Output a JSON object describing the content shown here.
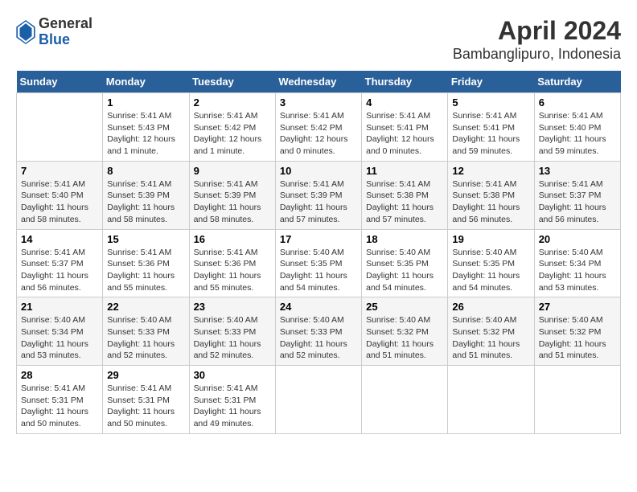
{
  "header": {
    "logo": {
      "line1": "General",
      "line2": "Blue"
    },
    "title": "April 2024",
    "subtitle": "Bambanglipuro, Indonesia"
  },
  "days_of_week": [
    "Sunday",
    "Monday",
    "Tuesday",
    "Wednesday",
    "Thursday",
    "Friday",
    "Saturday"
  ],
  "weeks": [
    [
      {
        "num": "",
        "info": ""
      },
      {
        "num": "1",
        "info": "Sunrise: 5:41 AM\nSunset: 5:43 PM\nDaylight: 12 hours\nand 1 minute."
      },
      {
        "num": "2",
        "info": "Sunrise: 5:41 AM\nSunset: 5:42 PM\nDaylight: 12 hours\nand 1 minute."
      },
      {
        "num": "3",
        "info": "Sunrise: 5:41 AM\nSunset: 5:42 PM\nDaylight: 12 hours\nand 0 minutes."
      },
      {
        "num": "4",
        "info": "Sunrise: 5:41 AM\nSunset: 5:41 PM\nDaylight: 12 hours\nand 0 minutes."
      },
      {
        "num": "5",
        "info": "Sunrise: 5:41 AM\nSunset: 5:41 PM\nDaylight: 11 hours\nand 59 minutes."
      },
      {
        "num": "6",
        "info": "Sunrise: 5:41 AM\nSunset: 5:40 PM\nDaylight: 11 hours\nand 59 minutes."
      }
    ],
    [
      {
        "num": "7",
        "info": "Sunrise: 5:41 AM\nSunset: 5:40 PM\nDaylight: 11 hours\nand 58 minutes."
      },
      {
        "num": "8",
        "info": "Sunrise: 5:41 AM\nSunset: 5:39 PM\nDaylight: 11 hours\nand 58 minutes."
      },
      {
        "num": "9",
        "info": "Sunrise: 5:41 AM\nSunset: 5:39 PM\nDaylight: 11 hours\nand 58 minutes."
      },
      {
        "num": "10",
        "info": "Sunrise: 5:41 AM\nSunset: 5:39 PM\nDaylight: 11 hours\nand 57 minutes."
      },
      {
        "num": "11",
        "info": "Sunrise: 5:41 AM\nSunset: 5:38 PM\nDaylight: 11 hours\nand 57 minutes."
      },
      {
        "num": "12",
        "info": "Sunrise: 5:41 AM\nSunset: 5:38 PM\nDaylight: 11 hours\nand 56 minutes."
      },
      {
        "num": "13",
        "info": "Sunrise: 5:41 AM\nSunset: 5:37 PM\nDaylight: 11 hours\nand 56 minutes."
      }
    ],
    [
      {
        "num": "14",
        "info": "Sunrise: 5:41 AM\nSunset: 5:37 PM\nDaylight: 11 hours\nand 56 minutes."
      },
      {
        "num": "15",
        "info": "Sunrise: 5:41 AM\nSunset: 5:36 PM\nDaylight: 11 hours\nand 55 minutes."
      },
      {
        "num": "16",
        "info": "Sunrise: 5:41 AM\nSunset: 5:36 PM\nDaylight: 11 hours\nand 55 minutes."
      },
      {
        "num": "17",
        "info": "Sunrise: 5:40 AM\nSunset: 5:35 PM\nDaylight: 11 hours\nand 54 minutes."
      },
      {
        "num": "18",
        "info": "Sunrise: 5:40 AM\nSunset: 5:35 PM\nDaylight: 11 hours\nand 54 minutes."
      },
      {
        "num": "19",
        "info": "Sunrise: 5:40 AM\nSunset: 5:35 PM\nDaylight: 11 hours\nand 54 minutes."
      },
      {
        "num": "20",
        "info": "Sunrise: 5:40 AM\nSunset: 5:34 PM\nDaylight: 11 hours\nand 53 minutes."
      }
    ],
    [
      {
        "num": "21",
        "info": "Sunrise: 5:40 AM\nSunset: 5:34 PM\nDaylight: 11 hours\nand 53 minutes."
      },
      {
        "num": "22",
        "info": "Sunrise: 5:40 AM\nSunset: 5:33 PM\nDaylight: 11 hours\nand 52 minutes."
      },
      {
        "num": "23",
        "info": "Sunrise: 5:40 AM\nSunset: 5:33 PM\nDaylight: 11 hours\nand 52 minutes."
      },
      {
        "num": "24",
        "info": "Sunrise: 5:40 AM\nSunset: 5:33 PM\nDaylight: 11 hours\nand 52 minutes."
      },
      {
        "num": "25",
        "info": "Sunrise: 5:40 AM\nSunset: 5:32 PM\nDaylight: 11 hours\nand 51 minutes."
      },
      {
        "num": "26",
        "info": "Sunrise: 5:40 AM\nSunset: 5:32 PM\nDaylight: 11 hours\nand 51 minutes."
      },
      {
        "num": "27",
        "info": "Sunrise: 5:40 AM\nSunset: 5:32 PM\nDaylight: 11 hours\nand 51 minutes."
      }
    ],
    [
      {
        "num": "28",
        "info": "Sunrise: 5:41 AM\nSunset: 5:31 PM\nDaylight: 11 hours\nand 50 minutes."
      },
      {
        "num": "29",
        "info": "Sunrise: 5:41 AM\nSunset: 5:31 PM\nDaylight: 11 hours\nand 50 minutes."
      },
      {
        "num": "30",
        "info": "Sunrise: 5:41 AM\nSunset: 5:31 PM\nDaylight: 11 hours\nand 49 minutes."
      },
      {
        "num": "",
        "info": ""
      },
      {
        "num": "",
        "info": ""
      },
      {
        "num": "",
        "info": ""
      },
      {
        "num": "",
        "info": ""
      }
    ]
  ]
}
